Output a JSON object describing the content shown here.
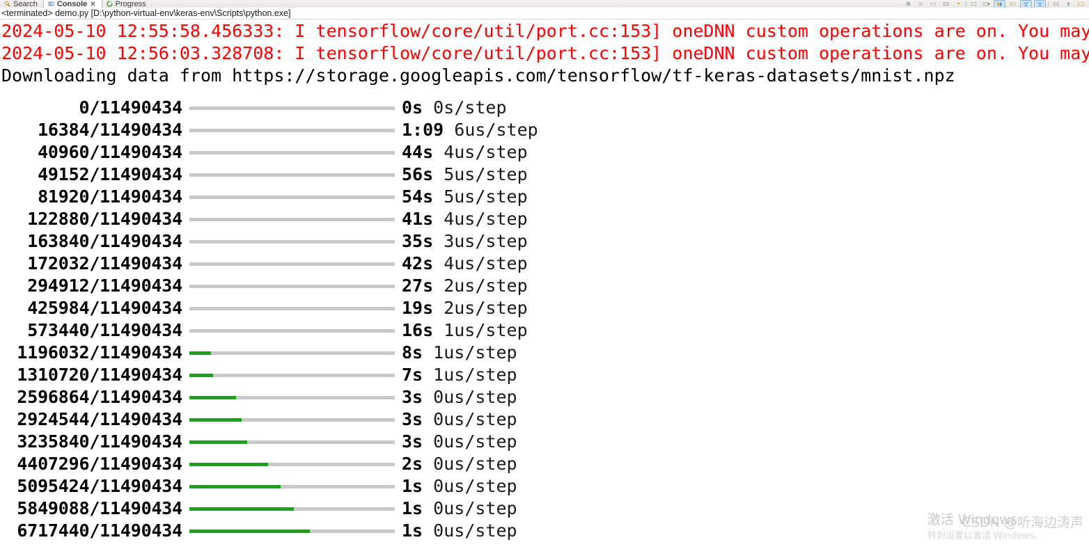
{
  "window": {
    "tabs": [
      {
        "label": "Search",
        "icon": "search-icon",
        "active": false
      },
      {
        "label": "Console",
        "icon": "console-icon",
        "active": true,
        "close_glyph": "✕"
      },
      {
        "label": "Progress",
        "icon": "progress-icon",
        "active": false
      }
    ],
    "toolbar_buttons": [
      {
        "name": "terminate-button",
        "glyph": "■"
      },
      {
        "name": "remove-launch-button",
        "glyph": "✕"
      },
      {
        "name": "remove-all-terminated-button",
        "glyph": "✕✕"
      },
      {
        "name": "display-selected-console-button",
        "glyph": "▬"
      },
      {
        "name": "open-console-button",
        "glyph": "▤"
      },
      {
        "name": "pin-console-button",
        "glyph": "⎘"
      },
      {
        "name": "scroll-lock-button",
        "glyph": "↧",
        "selected": true
      },
      {
        "name": "word-wrap-button",
        "glyph": "↵"
      },
      {
        "name": "show-console-on-output-button",
        "glyph": "↓",
        "selected": true
      },
      {
        "name": "show-console-on-error-button",
        "glyph": "↓",
        "selected": true
      },
      {
        "name": "new-console-view-button",
        "glyph": "▭"
      },
      {
        "name": "pin-view-button",
        "glyph": "⇧"
      },
      {
        "name": "view-menu-button",
        "glyph": "▭"
      }
    ],
    "launch_label": "<terminated> demo.py [D:\\python-virtual-env\\keras-env\\Scripts\\python.exe]"
  },
  "console": {
    "stderr_lines": [
      "2024-05-10 12:55:58.456333: I tensorflow/core/util/port.cc:153] oneDNN custom operations are on. You may",
      "2024-05-10 12:56:03.328708: I tensorflow/core/util/port.cc:153] oneDNN custom operations are on. You may"
    ],
    "stdout_lines": [
      "Downloading data from https://storage.googleapis.com/tensorflow/tf-keras-datasets/mnist.npz"
    ],
    "total_bytes": "11490434",
    "bar_colors": {
      "track": "#c9c9c9",
      "fill": "#1aa11a",
      "error_text": "#ff0000"
    },
    "progress_rows": [
      {
        "count": "0",
        "total": "11490434",
        "fraction": 0.0,
        "time": "0s",
        "step": "0s/step"
      },
      {
        "count": "16384",
        "total": "11490434",
        "fraction": 0.0,
        "time": "1:09",
        "step": "6us/step"
      },
      {
        "count": "40960",
        "total": "11490434",
        "fraction": 0.0,
        "time": "44s",
        "step": "4us/step"
      },
      {
        "count": "49152",
        "total": "11490434",
        "fraction": 0.0,
        "time": "56s",
        "step": "5us/step"
      },
      {
        "count": "81920",
        "total": "11490434",
        "fraction": 0.0,
        "time": "54s",
        "step": "5us/step"
      },
      {
        "count": "122880",
        "total": "11490434",
        "fraction": 0.0,
        "time": "41s",
        "step": "4us/step"
      },
      {
        "count": "163840",
        "total": "11490434",
        "fraction": 0.0,
        "time": "35s",
        "step": "3us/step"
      },
      {
        "count": "172032",
        "total": "11490434",
        "fraction": 0.0,
        "time": "42s",
        "step": "4us/step"
      },
      {
        "count": "294912",
        "total": "11490434",
        "fraction": 0.0,
        "time": "27s",
        "step": "2us/step"
      },
      {
        "count": "425984",
        "total": "11490434",
        "fraction": 0.0,
        "time": "19s",
        "step": "2us/step"
      },
      {
        "count": "573440",
        "total": "11490434",
        "fraction": 0.0,
        "time": "16s",
        "step": "1us/step"
      },
      {
        "count": "1196032",
        "total": "11490434",
        "fraction": 0.104,
        "time": "8s",
        "step": "1us/step"
      },
      {
        "count": "1310720",
        "total": "11490434",
        "fraction": 0.114,
        "time": "7s",
        "step": "1us/step"
      },
      {
        "count": "2596864",
        "total": "11490434",
        "fraction": 0.226,
        "time": "3s",
        "step": "0us/step"
      },
      {
        "count": "2924544",
        "total": "11490434",
        "fraction": 0.255,
        "time": "3s",
        "step": "0us/step"
      },
      {
        "count": "3235840",
        "total": "11490434",
        "fraction": 0.282,
        "time": "3s",
        "step": "0us/step"
      },
      {
        "count": "4407296",
        "total": "11490434",
        "fraction": 0.384,
        "time": "2s",
        "step": "0us/step"
      },
      {
        "count": "5095424",
        "total": "11490434",
        "fraction": 0.443,
        "time": "1s",
        "step": "0us/step"
      },
      {
        "count": "5849088",
        "total": "11490434",
        "fraction": 0.509,
        "time": "1s",
        "step": "0us/step"
      },
      {
        "count": "6717440",
        "total": "11490434",
        "fraction": 0.585,
        "time": "1s",
        "step": "0us/step"
      }
    ]
  },
  "watermarks": {
    "windows_activate": "激活 Windows",
    "windows_activate_sub": "转到设置以激活 Windows。",
    "csdn": "CSDN @听海边涛声"
  }
}
